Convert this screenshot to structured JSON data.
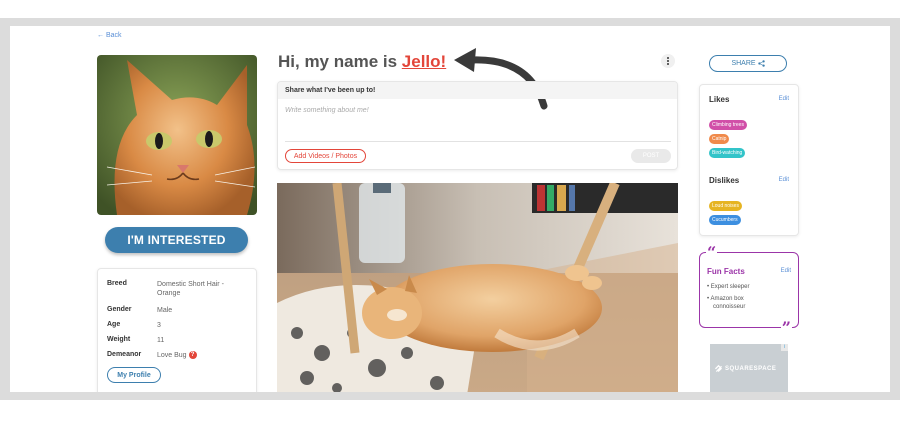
{
  "nav": {
    "back_label": "← Back"
  },
  "profile": {
    "title_prefix": "Hi, my name is",
    "name": "Jello!",
    "interested_label": "I'M INTERESTED",
    "details": [
      {
        "label": "Breed",
        "value": "Domestic Short Hair - Orange"
      },
      {
        "label": "Gender",
        "value": "Male"
      },
      {
        "label": "Age",
        "value": "3"
      },
      {
        "label": "Weight",
        "value": "11"
      },
      {
        "label": "Demeanor",
        "value": "Love Bug"
      }
    ],
    "my_profile_label": "My Profile"
  },
  "post": {
    "header": "Share what I've been up to!",
    "placeholder": "Write something about me!",
    "add_media_label": "Add Videos / Photos",
    "post_label": "POST"
  },
  "share": {
    "label": "SHARE"
  },
  "likes": {
    "heading": "Likes",
    "edit_label": "Edit",
    "tags": [
      {
        "label": "Climbing trees",
        "color": "#d14fa8"
      },
      {
        "label": "Catnip",
        "color": "#f08a4b"
      },
      {
        "label": "Bird-watching",
        "color": "#32c4c9"
      }
    ]
  },
  "dislikes": {
    "heading": "Dislikes",
    "edit_label": "Edit",
    "tags": [
      {
        "label": "Loud noises",
        "color": "#e6b422"
      },
      {
        "label": "Cucumbers",
        "color": "#3d8fe0"
      }
    ]
  },
  "fun_facts": {
    "heading": "Fun Facts",
    "edit_label": "Edit",
    "items": [
      "Expert sleeper",
      "Amazon box connoisseur"
    ]
  },
  "ad": {
    "brand": "SQUARESPACE"
  },
  "colors": {
    "accent_red": "#e3463a",
    "primary_blue": "#3d7fae",
    "fun_facts_purple": "#9b35a8"
  },
  "icons": [
    "arrow-annotation-icon",
    "kebab-menu-icon",
    "share-icon",
    "help-icon",
    "quote-open-icon",
    "quote-close-icon",
    "ad-info-icon"
  ]
}
